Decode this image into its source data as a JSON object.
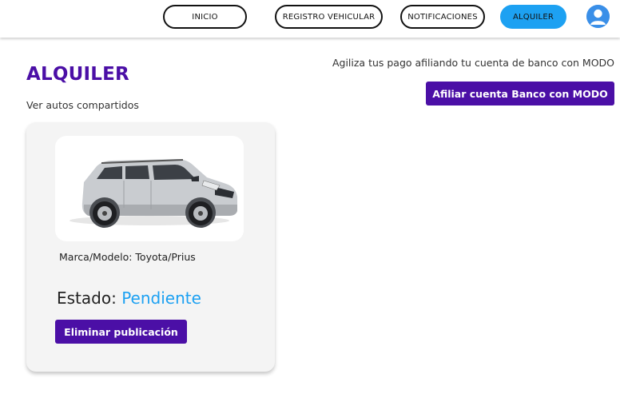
{
  "nav": {
    "items": [
      {
        "label": "INICIO"
      },
      {
        "label": "REGISTRO VEHICULAR"
      },
      {
        "label": "NOTIFICACIONES"
      },
      {
        "label": "ALQUILER"
      }
    ],
    "active": "ALQUILER",
    "avatar_icon": "user-avatar-icon"
  },
  "main": {
    "title": "ALQUILER",
    "subtitle": "Ver autos compartidos",
    "promo_text": "Agiliza tus pago afiliando tu cuenta  de banco con MODO",
    "promo_button": "Afiliar cuenta Banco con MODO"
  },
  "card": {
    "model_label": "Marca/Modelo: Toyota/Prius",
    "status_label": "Estado:",
    "status_value": "Pendiente",
    "delete_button": "Eliminar publicación",
    "image_icon": "car-image"
  },
  "colors": {
    "accent_purple": "#4b0fa6",
    "accent_blue": "#1da1f2"
  }
}
